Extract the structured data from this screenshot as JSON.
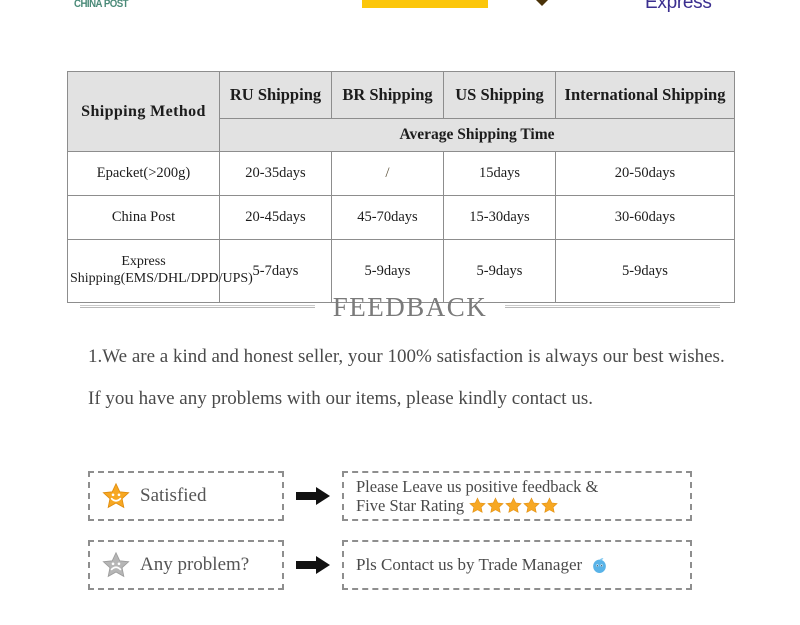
{
  "logos": {
    "china_post_text": "CHINA POST",
    "china_post_color": "#4a8a78",
    "yellow_bar_color": "#fcc60a",
    "chevron_color": "#4a3208",
    "express_text": "Express",
    "express_color": "#3b2f8f"
  },
  "shipping_table": {
    "method_header": "Shipping  Method",
    "columns": [
      "RU Shipping",
      "BR Shipping",
      "US Shipping",
      "International Shipping"
    ],
    "subheader": "Average Shipping Time",
    "header_bg": "#e2e2e2",
    "border_color": "#8d8d8d",
    "rows": [
      {
        "method": "Epacket(>200g)",
        "values": [
          "20-35days",
          "/",
          "15days",
          "20-50days"
        ]
      },
      {
        "method": "China Post",
        "values": [
          "20-45days",
          "45-70days",
          "15-30days",
          "30-60days"
        ]
      },
      {
        "method": "Express Shipping(EMS/DHL/DPD/UPS)",
        "values": [
          "5-7days",
          "5-9days",
          "5-9days",
          "5-9days"
        ]
      }
    ]
  },
  "feedback": {
    "title": "FEEDBACK",
    "paragraph": "1.We are a kind and honest seller, your 100% satisfaction is always our best wishes. If you have any problems with our items, please kindly contact us.",
    "rows": [
      {
        "left_label": "Satisfied",
        "left_icon": "smiling-star-icon",
        "left_icon_color": "#f7a823",
        "arrow": "➜",
        "right_line1": "Please Leave us positive feedback &",
        "right_line2": "Five Star Rating",
        "right_stars": 5,
        "star_color": "#f7a823"
      },
      {
        "left_label": "Any problem?",
        "left_icon": "sad-star-icon",
        "left_icon_color": "#b6b6b6",
        "arrow": "➜",
        "right_line1": "Pls Contact us by Trade Manager",
        "right_line2": "",
        "right_stars": 0,
        "trade_manager_icon": "trade-manager-icon",
        "trade_manager_color": "#59b3e8"
      }
    ]
  }
}
